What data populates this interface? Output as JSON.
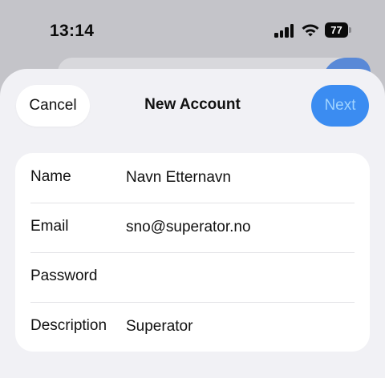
{
  "status_bar": {
    "time": "13:14",
    "battery_level": "77"
  },
  "nav": {
    "cancel_label": "Cancel",
    "title": "New Account",
    "next_label": "Next"
  },
  "form": {
    "fields": [
      {
        "label": "Name",
        "value": "Navn Etternavn"
      },
      {
        "label": "Email",
        "value": "sno@superator.no"
      },
      {
        "label": "Password",
        "value": ""
      },
      {
        "label": "Description",
        "value": "Superator"
      }
    ]
  },
  "colors": {
    "accent": "#3b8cf1",
    "sheet_background": "#f1f1f5",
    "card_background": "#ffffff"
  },
  "icons": [
    "signal-icon",
    "wifi-icon",
    "battery-icon"
  ]
}
